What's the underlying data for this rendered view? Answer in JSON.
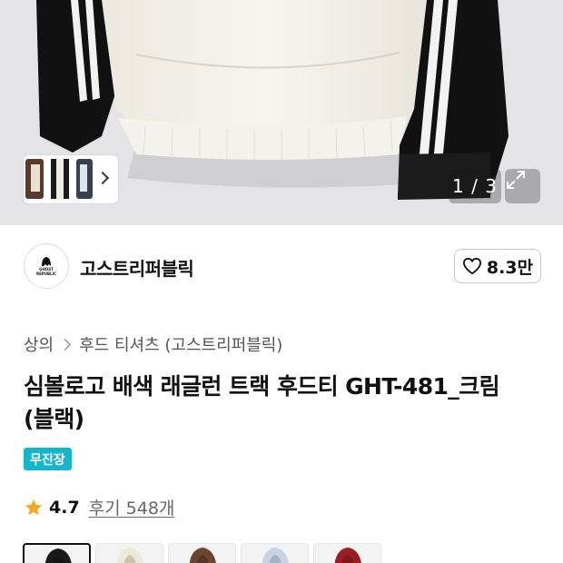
{
  "gallery": {
    "counter": "1 / 3",
    "expand_icon": "expand-icon",
    "thumbnail_next_icon": "chevron-right-icon"
  },
  "brand": {
    "logo_text_line1": "GHOST",
    "logo_text_line2": "REPUBLIC",
    "name": "고스트리퍼블릭",
    "likes": "8.3만",
    "like_icon": "heart-icon"
  },
  "breadcrumb": {
    "category": "상의",
    "subcategory": "후드 티셔츠 (고스트리퍼블릭)"
  },
  "product": {
    "title": "심볼로고 배색 래글런 트랙 후드티 GHT-481_크림(블랙)",
    "badge": "무진장"
  },
  "rating": {
    "score": "4.7",
    "reviews": "후기 548개",
    "star_color": "#f5a623"
  },
  "color_options": [
    {
      "name": "black",
      "color": "#1a1a1a",
      "accent": "#111111",
      "selected": true
    },
    {
      "name": "cream",
      "color": "#efe9dc",
      "accent": "#b9a88a",
      "selected": false
    },
    {
      "name": "brown",
      "color": "#6b4530",
      "accent": "#4a2d1e",
      "selected": false
    },
    {
      "name": "light-blue",
      "color": "#c9d3e2",
      "accent": "#8d9cb3",
      "selected": false
    },
    {
      "name": "red",
      "color": "#9a1f22",
      "accent": "#6e1214",
      "selected": false
    }
  ]
}
